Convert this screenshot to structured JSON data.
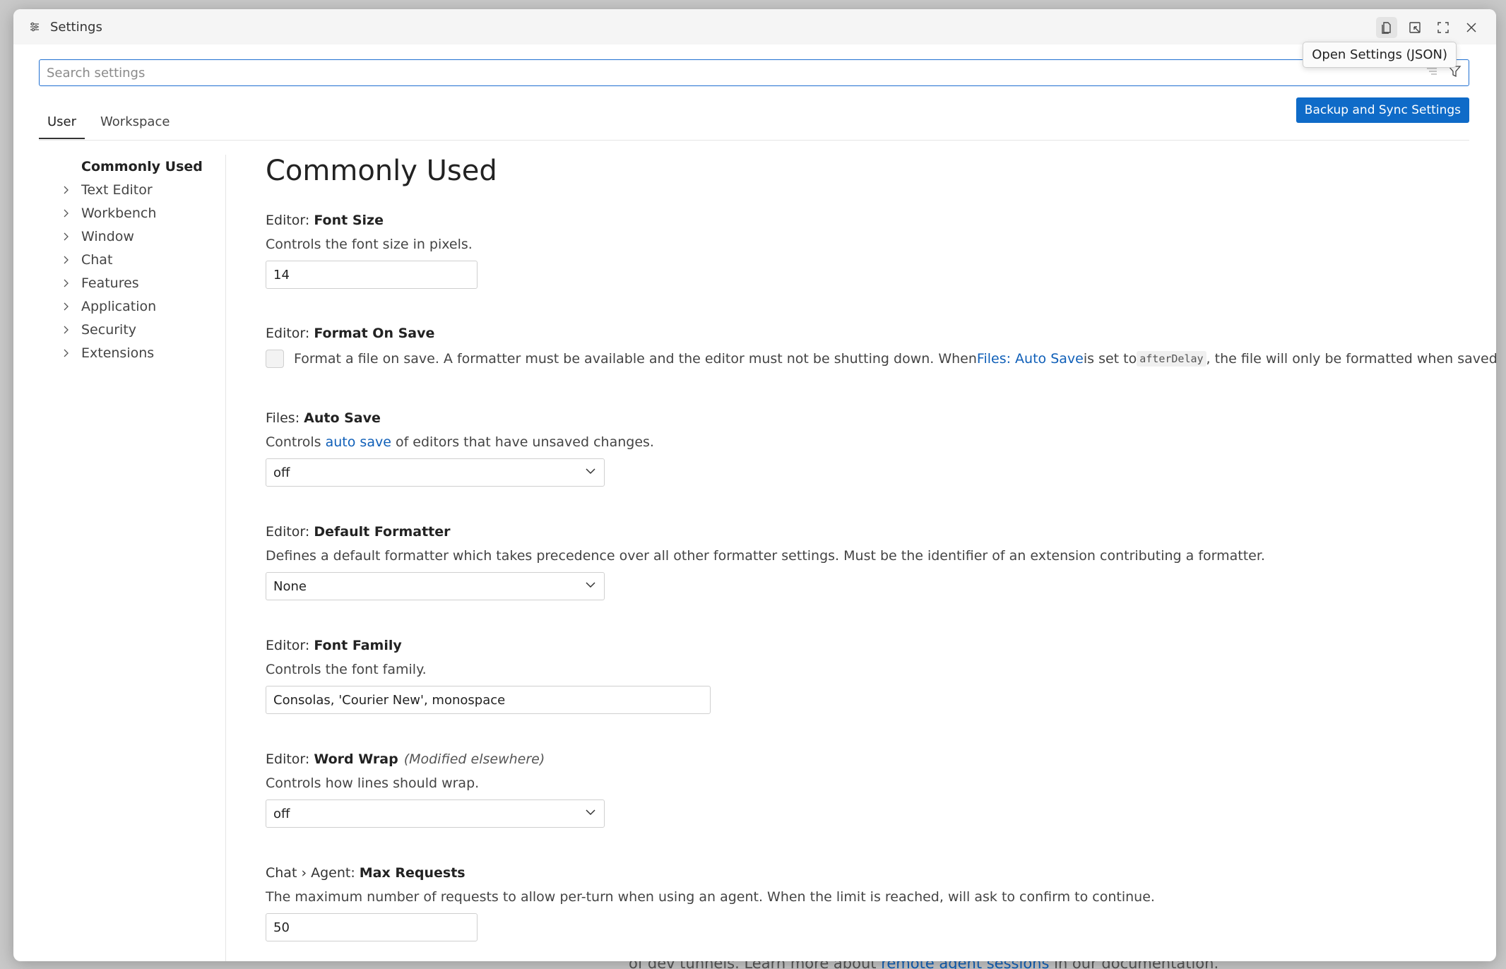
{
  "background": {
    "text_before": "of dev tunnels. Learn more about ",
    "link": "remote agent sessions",
    "text_after": " in our documentation."
  },
  "window": {
    "title": "Settings",
    "tooltip": "Open Settings (JSON)"
  },
  "search": {
    "placeholder": "Search settings"
  },
  "tabs": [
    {
      "label": "User",
      "active": true
    },
    {
      "label": "Workspace",
      "active": false
    }
  ],
  "sync_button": "Backup and Sync Settings",
  "toc": [
    "Commonly Used",
    "Text Editor",
    "Workbench",
    "Window",
    "Chat",
    "Features",
    "Application",
    "Security",
    "Extensions"
  ],
  "page_title": "Commonly Used",
  "settings": {
    "font_size": {
      "category": "Editor: ",
      "name": "Font Size",
      "description": "Controls the font size in pixels.",
      "value": "14"
    },
    "format_on_save": {
      "category": "Editor: ",
      "name": "Format On Save",
      "desc_part1": "Format a file on save. A formatter must be available and the editor must not be shutting down. When ",
      "desc_link": "Files: Auto Save",
      "desc_part2": " is set to ",
      "desc_code": "afterDelay",
      "desc_part3": ", the file will only be formatted when saved explicitly.",
      "checked": false
    },
    "auto_save": {
      "category": "Files: ",
      "name": "Auto Save",
      "desc_part1": "Controls ",
      "desc_link": "auto save",
      "desc_part2": " of editors that have unsaved changes.",
      "value": "off"
    },
    "default_formatter": {
      "category": "Editor: ",
      "name": "Default Formatter",
      "description": "Defines a default formatter which takes precedence over all other formatter settings. Must be the identifier of an extension contributing a formatter.",
      "value": "None"
    },
    "font_family": {
      "category": "Editor: ",
      "name": "Font Family",
      "description": "Controls the font family.",
      "value": "Consolas, 'Courier New', monospace"
    },
    "word_wrap": {
      "category": "Editor: ",
      "name": "Word Wrap",
      "modified": "(Modified elsewhere)",
      "description": "Controls how lines should wrap.",
      "value": "off"
    },
    "max_requests": {
      "category": "Chat › Agent: ",
      "name": "Max Requests",
      "description": "The maximum number of requests to allow per-turn when using an agent. When the limit is reached, will ask to confirm to continue.",
      "value": "50"
    }
  }
}
